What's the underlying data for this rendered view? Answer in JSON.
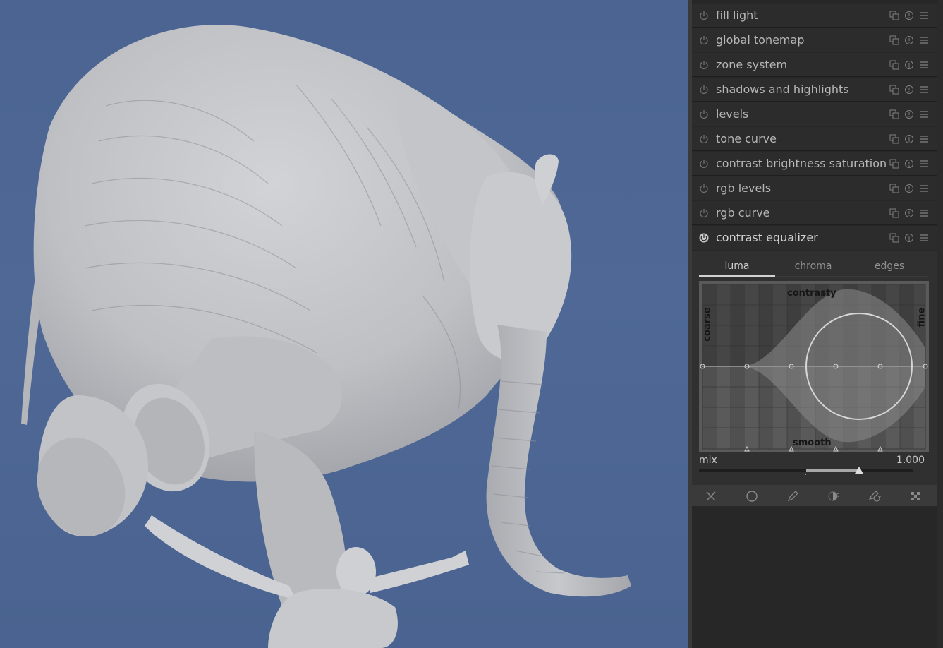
{
  "modules": [
    {
      "label": "fill light",
      "active": false
    },
    {
      "label": "global tonemap",
      "active": false
    },
    {
      "label": "zone system",
      "active": false
    },
    {
      "label": "shadows and highlights",
      "active": false
    },
    {
      "label": "levels",
      "active": false
    },
    {
      "label": "tone curve",
      "active": false
    },
    {
      "label": "contrast brightness saturation",
      "active": false
    },
    {
      "label": "rgb levels",
      "active": false
    },
    {
      "label": "rgb curve",
      "active": false
    },
    {
      "label": "contrast equalizer",
      "active": true
    }
  ],
  "equalizer": {
    "tabs": [
      "luma",
      "chroma",
      "edges"
    ],
    "selected_tab": "luma",
    "graph_labels": {
      "top": "contrasty",
      "bottom": "smooth",
      "left": "coarse",
      "right": "fine"
    },
    "mix": {
      "label": "mix",
      "value_text": "1.000",
      "value": 1.0
    }
  },
  "mask_buttons": [
    "off-icon",
    "drawn-mask-icon",
    "parametric-mask-icon",
    "drawn-parametric-mask-icon",
    "raster-mask-icon",
    "uniform-icon"
  ],
  "colors": {
    "sky": "#4f6896",
    "panel_bg": "#272727",
    "module_bg": "#2c2c2c",
    "text": "#b6b6b6"
  }
}
